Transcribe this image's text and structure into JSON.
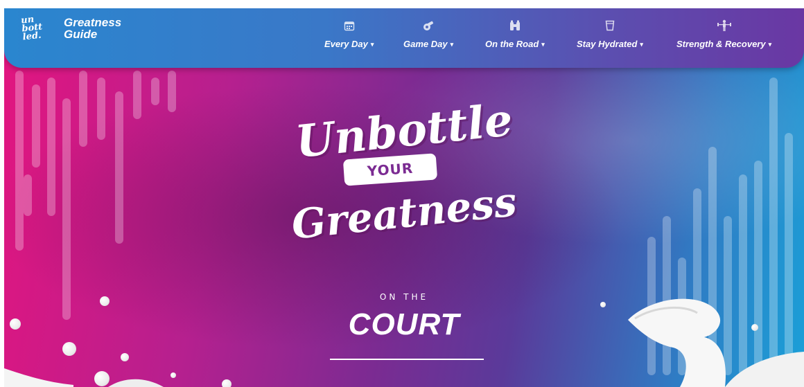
{
  "brand": {
    "logo_lines": [
      "un",
      "bott",
      "led."
    ],
    "name_line1": "Greatness",
    "name_line2": "Guide"
  },
  "nav": {
    "items": [
      {
        "label": "Every Day",
        "icon": "calendar-icon"
      },
      {
        "label": "Game Day",
        "icon": "whistle-icon"
      },
      {
        "label": "On the Road",
        "icon": "binoculars-icon"
      },
      {
        "label": "Stay Hydrated",
        "icon": "cup-icon"
      },
      {
        "label": "Strength & Recovery",
        "icon": "weightlifter-icon"
      }
    ],
    "caret": "▾"
  },
  "hero": {
    "headline_line1": "Unbottle",
    "headline_badge": "YOUR",
    "headline_line2": "Greatness",
    "subtitle_small": "ON THE",
    "subtitle_big": "COURT"
  },
  "colors": {
    "nav_start": "#2a86cf",
    "nav_end": "#6a37a3",
    "hero_pink": "#e3157f",
    "hero_purple": "#7b2b92",
    "hero_blue": "#1aa0d8",
    "text": "#ffffff"
  }
}
